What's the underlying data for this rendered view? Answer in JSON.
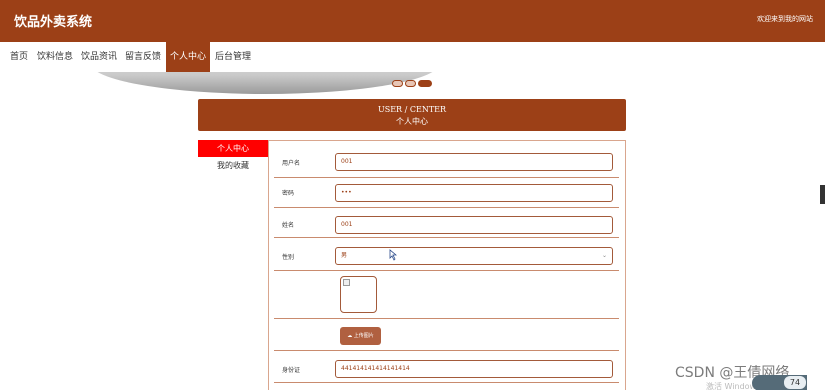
{
  "header": {
    "site_title": "饮品外卖系统",
    "welcome_text": "欢迎来到我的网站"
  },
  "nav": {
    "items": [
      "首页",
      "饮料信息",
      "饮品资讯",
      "留言反馈",
      "个人中心",
      "后台管理"
    ],
    "active": "个人中心"
  },
  "banner": {
    "dots": 3,
    "active_dot": 3
  },
  "section": {
    "title_en": "USER / CENTER",
    "title_cn": "个人中心"
  },
  "sidebar": {
    "items": [
      "个人中心",
      "我的收藏"
    ]
  },
  "form": {
    "username_label": "用户名",
    "username_value": "001",
    "password_label": "密码",
    "password_value": "•••",
    "name_label": "姓名",
    "name_value": "001",
    "gender_label": "性别",
    "gender_value": "男",
    "upload_label": "上传图片",
    "idcard_label": "身份证",
    "idcard_value": "441414141414141414"
  },
  "watermark": {
    "text": "CSDN @王倩网络",
    "activate_text": "激活 Windows",
    "badge_number": "74"
  },
  "colors": {
    "brand": "#9c4017",
    "active_sidebar": "#ff0000",
    "border": "#c98b6e"
  }
}
